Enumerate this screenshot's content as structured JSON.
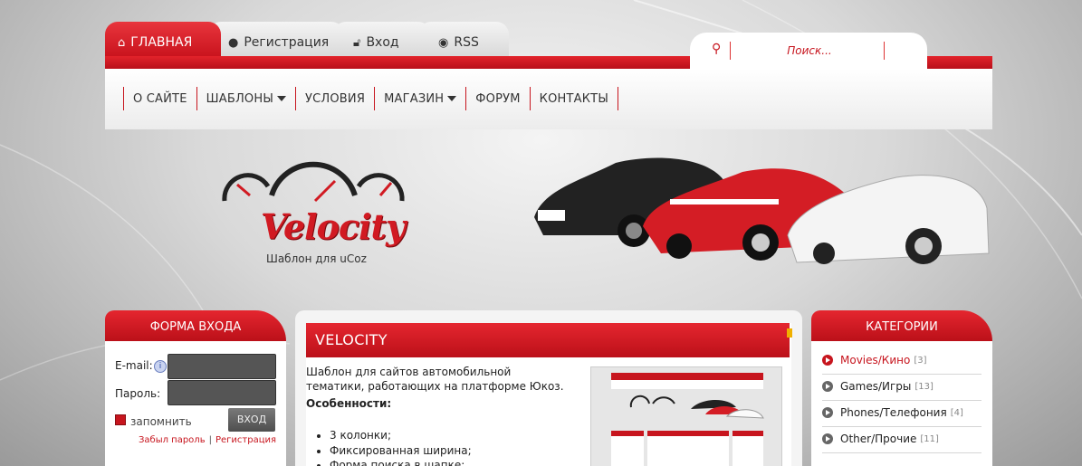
{
  "tabs": [
    {
      "label": "ГЛАВНАЯ",
      "icon": "home-icon",
      "active": true
    },
    {
      "label": "Регистрация",
      "icon": "user-icon",
      "active": false
    },
    {
      "label": "Вход",
      "icon": "lock-icon",
      "active": false
    },
    {
      "label": "RSS",
      "icon": "rss-icon",
      "active": false
    }
  ],
  "search": {
    "placeholder": "Поиск...",
    "icon": "search-icon"
  },
  "nav": [
    {
      "label": "О САЙТЕ",
      "dropdown": false
    },
    {
      "label": "ШАБЛОНЫ",
      "dropdown": true
    },
    {
      "label": "УСЛОВИЯ",
      "dropdown": false
    },
    {
      "label": "МАГАЗИН",
      "dropdown": true
    },
    {
      "label": "ФОРУМ",
      "dropdown": false
    },
    {
      "label": "КОНТАКТЫ",
      "dropdown": false
    }
  ],
  "logo": {
    "title": "Velocity",
    "subtitle": "Шаблон для uCoz"
  },
  "login": {
    "title": "ФОРМА ВХОДА",
    "email_label": "E-mail:",
    "password_label": "Пароль:",
    "remember_label": "запомнить",
    "button_label": "ВХОД",
    "forgot_link": "Забыл пароль",
    "separator": "|",
    "register_link": "Регистрация"
  },
  "post": {
    "title": "VELOCITY",
    "text": "Шаблон для сайтов автомобильной тематики, работающих на платформе Юкоз.",
    "features_label": "Особенности:",
    "features": [
      "3 колонки;",
      "Фиксированная ширина;",
      "Форма поиска в шапке;"
    ]
  },
  "categories": {
    "title": "КАТЕГОРИИ",
    "items": [
      {
        "name": "Movies/Кино",
        "count": "[3]",
        "active": true
      },
      {
        "name": "Games/Игры",
        "count": "[13]",
        "active": false
      },
      {
        "name": "Phones/Телефония",
        "count": "[4]",
        "active": false
      },
      {
        "name": "Other/Прочие",
        "count": "[11]",
        "active": false
      }
    ]
  },
  "colors": {
    "accent": "#d11a22",
    "dark": "#333333"
  }
}
